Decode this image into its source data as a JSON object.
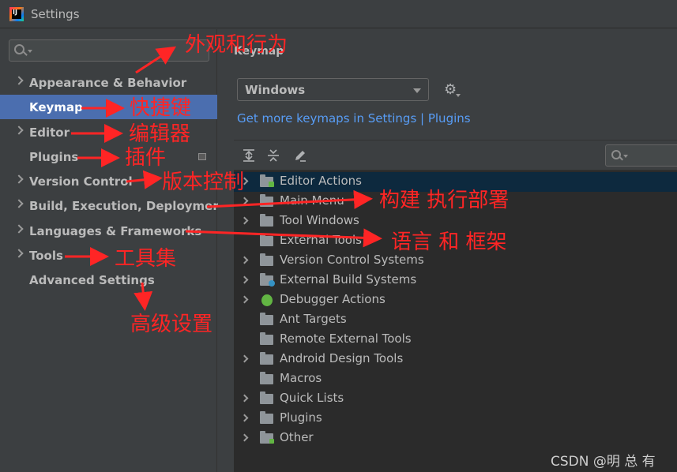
{
  "window": {
    "title": "Settings",
    "app_icon_text": "IJ"
  },
  "sidebar": {
    "search_placeholder": "",
    "items": [
      {
        "label": "Appearance & Behavior"
      },
      {
        "label": "Keymap"
      },
      {
        "label": "Editor"
      },
      {
        "label": "Plugins"
      },
      {
        "label": "Version Control"
      },
      {
        "label": "Build, Execution, Deployment"
      },
      {
        "label": "Languages & Frameworks"
      },
      {
        "label": "Tools"
      },
      {
        "label": "Advanced Settings"
      }
    ]
  },
  "main": {
    "section_title": "Keymap",
    "keymap_value": "Windows",
    "more_link": "Get more keymaps in Settings | Plugins",
    "tree": [
      {
        "label": "Editor Actions"
      },
      {
        "label": "Main Menu"
      },
      {
        "label": "Tool Windows"
      },
      {
        "label": "External Tools"
      },
      {
        "label": "Version Control Systems"
      },
      {
        "label": "External Build Systems"
      },
      {
        "label": "Debugger Actions"
      },
      {
        "label": "Ant Targets"
      },
      {
        "label": "Remote External Tools"
      },
      {
        "label": "Android Design Tools"
      },
      {
        "label": "Macros"
      },
      {
        "label": "Quick Lists"
      },
      {
        "label": "Plugins"
      },
      {
        "label": "Other"
      }
    ]
  },
  "annotations": {
    "appearance": "外观和行为",
    "keymap": "快捷键",
    "editor": "编辑器",
    "plugins": "插件",
    "version_control": "版本控制",
    "build": "构建 执行部署",
    "languages": "语言 和 框架",
    "tools": "工具集",
    "advanced": "高级设置"
  },
  "watermark": "CSDN @明 总 有",
  "colors": {
    "selection": "#4b6eaf",
    "link": "#589df6",
    "annotation": "#ff2525"
  }
}
